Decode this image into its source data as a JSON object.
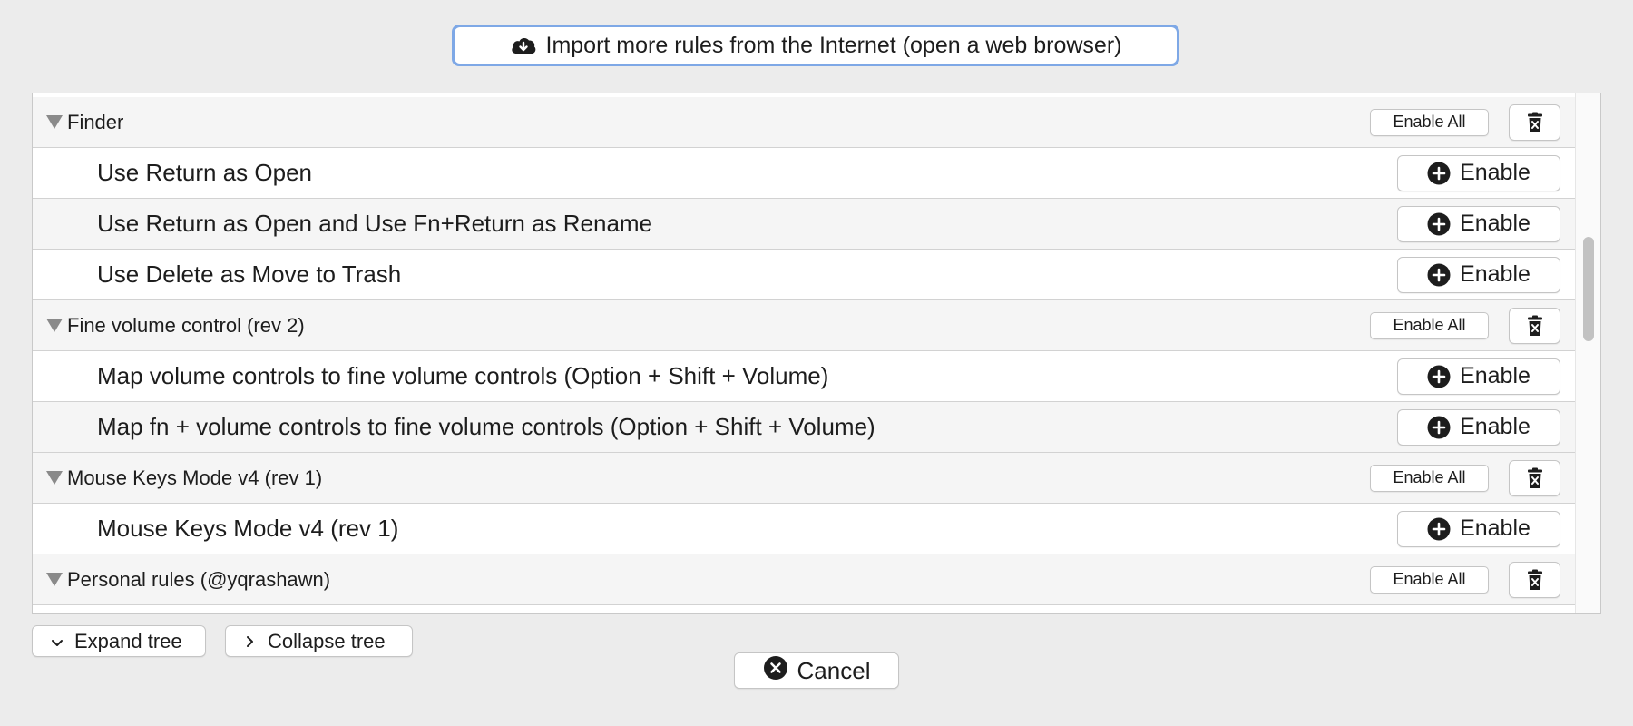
{
  "import_button": {
    "label": "Import more rules from the Internet (open a web browser)",
    "icon": "cloud-download-icon"
  },
  "rows": [
    {
      "type": "group",
      "label": "Finder",
      "enable_all_label": "Enable All"
    },
    {
      "type": "rule",
      "label": "Use Return as Open",
      "enable_label": "Enable"
    },
    {
      "type": "rule",
      "label": "Use Return as Open and Use Fn+Return as Rename",
      "enable_label": "Enable"
    },
    {
      "type": "rule",
      "label": "Use Delete as Move to Trash",
      "enable_label": "Enable"
    },
    {
      "type": "group",
      "label": "Fine volume control (rev 2)",
      "enable_all_label": "Enable All"
    },
    {
      "type": "rule",
      "label": "Map volume controls to fine volume controls (Option + Shift + Volume)",
      "enable_label": "Enable"
    },
    {
      "type": "rule",
      "label": "Map fn + volume controls to fine volume controls (Option + Shift + Volume)",
      "enable_label": "Enable"
    },
    {
      "type": "group",
      "label": "Mouse Keys Mode v4 (rev 1)",
      "enable_all_label": "Enable All"
    },
    {
      "type": "rule",
      "label": "Mouse Keys Mode v4 (rev 1)",
      "enable_label": "Enable"
    },
    {
      "type": "group",
      "label": "Personal rules (@yqrashawn)",
      "enable_all_label": "Enable All"
    }
  ],
  "footer": {
    "expand_label": "Expand tree",
    "collapse_label": "Collapse tree",
    "cancel_label": "Cancel"
  },
  "colors": {
    "background": "#ececec",
    "focus_ring": "#7ea8e6",
    "alt_row": "#f5f5f5"
  }
}
